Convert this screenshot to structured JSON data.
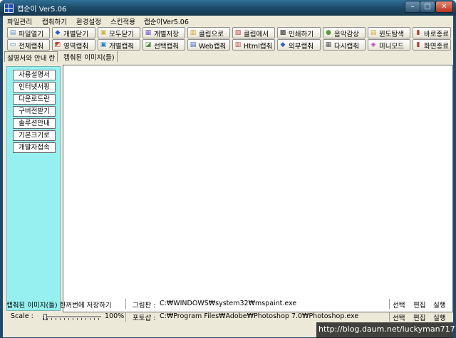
{
  "window": {
    "title": "캡순이 Ver5.06",
    "min_glyph": "–",
    "max_glyph": "□",
    "close_glyph": "✕"
  },
  "menu": [
    "파일관리",
    "캡춰하기",
    "환경설정",
    "스킨적용",
    "캡순이Ver5.06"
  ],
  "toolbar_row1": [
    {
      "label": "파일열기",
      "icon": "open-icon",
      "glyph": "▤",
      "color": "#6a8fd6"
    },
    {
      "label": "개별닫기",
      "icon": "close-one-icon",
      "glyph": "◆",
      "color": "#2a5bc8"
    },
    {
      "label": "모두닫기",
      "icon": "close-all-icon",
      "glyph": "▣",
      "color": "#d4b24a"
    },
    {
      "label": "개별저장",
      "icon": "save-icon",
      "glyph": "▦",
      "color": "#7a5acb"
    },
    {
      "label": "클립으로",
      "icon": "to-clipboard-icon",
      "glyph": "▥",
      "color": "#c9a23b"
    },
    {
      "label": "클립에서",
      "icon": "from-clipboard-icon",
      "glyph": "▧",
      "color": "#c04a4a"
    },
    {
      "label": "인쇄하기",
      "icon": "print-icon",
      "glyph": "▩",
      "color": "#333333"
    },
    {
      "label": "음악감상",
      "icon": "music-icon",
      "glyph": "●",
      "color": "#5a9a3a"
    },
    {
      "label": "윈도탐색",
      "icon": "explorer-icon",
      "glyph": "▤",
      "color": "#caa53d"
    },
    {
      "label": "바로종료",
      "icon": "exit-icon",
      "glyph": "▮",
      "color": "#c0392b"
    }
  ],
  "toolbar_row2": [
    {
      "label": "전체캡춰",
      "icon": "full-capture-icon",
      "glyph": "▭",
      "color": "#3a6fc4"
    },
    {
      "label": "영역캡춰",
      "icon": "region-capture-icon",
      "glyph": "◩",
      "color": "#c0392b"
    },
    {
      "label": "개별캡춰",
      "icon": "window-capture-icon",
      "glyph": "▣",
      "color": "#2f7fc4"
    },
    {
      "label": "선택캡춰",
      "icon": "select-capture-icon",
      "glyph": "◪",
      "color": "#4a8a3a"
    },
    {
      "label": "Web캡춰",
      "icon": "web-capture-icon",
      "glyph": "▤",
      "color": "#2a5bc8"
    },
    {
      "label": "Html캡춰",
      "icon": "html-capture-icon",
      "glyph": "▥",
      "color": "#c04a4a"
    },
    {
      "label": "외부캡춰",
      "icon": "external-capture-icon",
      "glyph": "◆",
      "color": "#2a5bc8"
    },
    {
      "label": "다시캡춰",
      "icon": "recapture-icon",
      "glyph": "▦",
      "color": "#555555"
    },
    {
      "label": "미니모드",
      "icon": "mini-mode-icon",
      "glyph": "◈",
      "color": "#b03ab0"
    },
    {
      "label": "화면종료",
      "icon": "screen-exit-icon",
      "glyph": "▮",
      "color": "#c0392b"
    }
  ],
  "tabs": [
    "설명서와 안내 란",
    "캡춰된 이미지(들)"
  ],
  "sidebar": [
    "사용설명서",
    "인터넷서핑",
    "다운로드란",
    "구버전받기",
    "솔루션안내",
    "기본크기로",
    "개발자접속"
  ],
  "status1": {
    "save_label": "캡춰된 이미지(들) 한꺼번에 저장하기",
    "painter_label": "그림판 :",
    "painter_path": "C:₩WINDOWS₩system32₩mspaint.exe",
    "select": "선택",
    "edit": "편집",
    "run": "실행"
  },
  "status2": {
    "scale_label": "Scale :",
    "scale_value": "100%",
    "scale_fraction": 0.0,
    "photoshop_label": "포토샵 :",
    "photoshop_path": "C:₩Program Files₩Adobe₩Photoshop 7.0₩Photoshop.exe",
    "select": "선택",
    "edit": "편집",
    "run": "실행"
  },
  "watermark": "http://blog.daum.net/luckyman717"
}
